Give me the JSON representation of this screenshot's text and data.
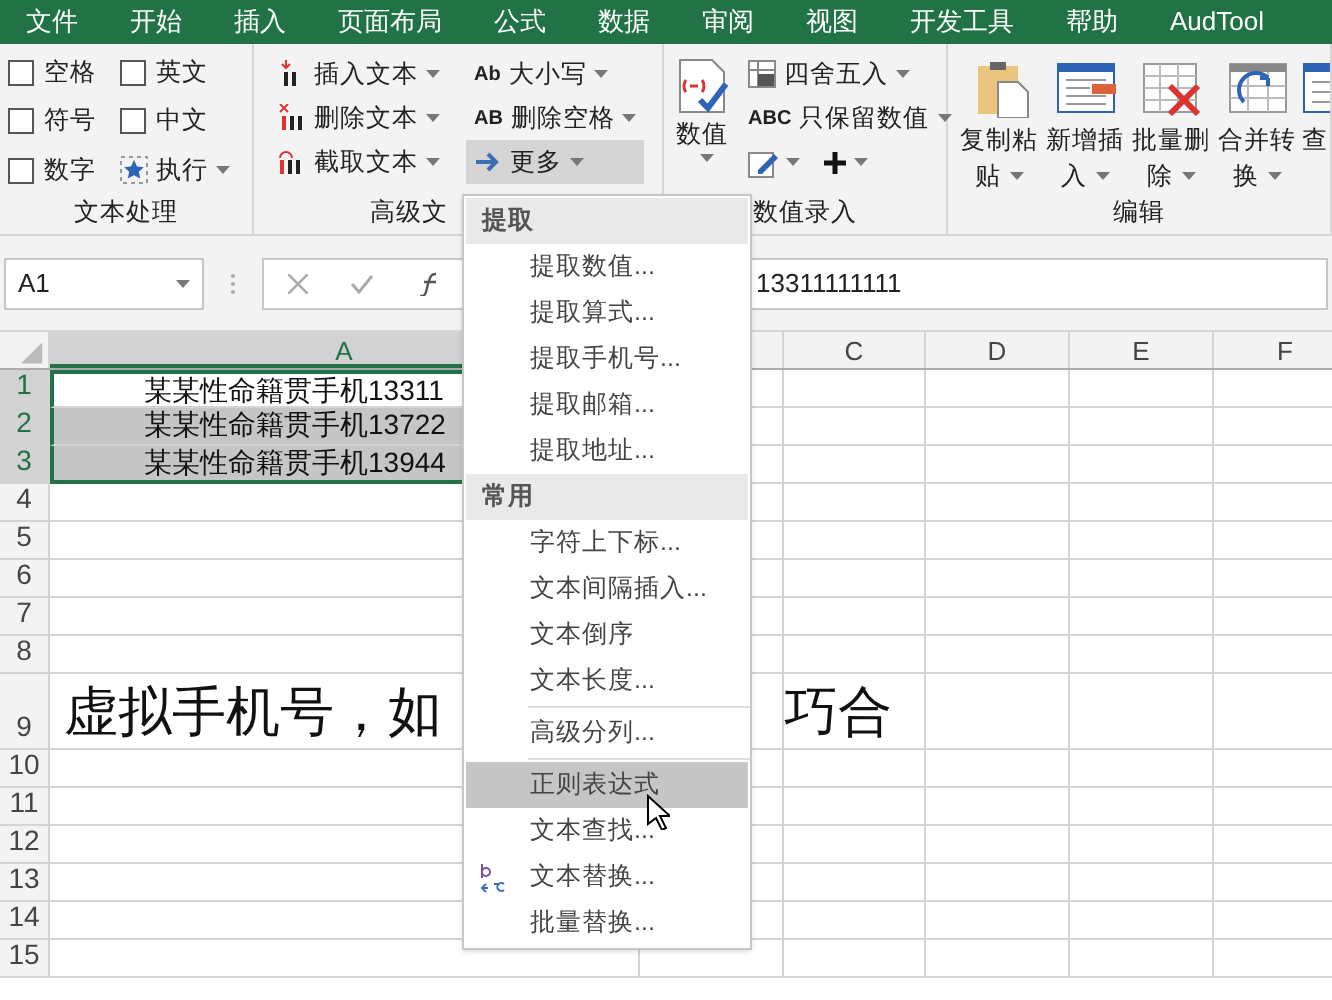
{
  "menu_bar": {
    "tabs": [
      "文件",
      "开始",
      "插入",
      "页面布局",
      "公式",
      "数据",
      "审阅",
      "视图",
      "开发工具",
      "帮助",
      "AudTool"
    ]
  },
  "ribbon": {
    "groups": [
      {
        "label": "文本处理",
        "items": [
          {
            "kind": "checkbox",
            "label": "空格",
            "checked": false
          },
          {
            "kind": "checkbox",
            "label": "英文",
            "checked": false
          },
          {
            "kind": "checkbox",
            "label": "符号",
            "checked": false
          },
          {
            "kind": "checkbox",
            "label": "中文",
            "checked": false
          },
          {
            "kind": "checkbox",
            "label": "数字",
            "checked": false
          },
          {
            "kind": "run",
            "label": "执行"
          }
        ]
      },
      {
        "label": "高级文",
        "items": [
          {
            "kind": "insert",
            "label": "插入文本",
            "selected": false
          },
          {
            "kind": "delete",
            "label": "删除文本",
            "selected": false
          },
          {
            "kind": "cut",
            "label": "截取文本",
            "selected": false
          },
          {
            "kind": "case",
            "icon_text": "Ab",
            "label": "大小写",
            "selected": false
          },
          {
            "kind": "trim",
            "icon_text": "AB",
            "label": "删除空格",
            "selected": false
          },
          {
            "kind": "more",
            "label": "更多",
            "selected": true
          }
        ]
      },
      {
        "label": "数值录入",
        "items": [
          {
            "kind": "large",
            "label": "数值"
          },
          {
            "kind": "round",
            "label": "四舍五入"
          },
          {
            "kind": "numonly",
            "icon_text": "ABC",
            "label": "只保留数值"
          },
          {
            "kind": "pencil"
          },
          {
            "kind": "plus"
          }
        ]
      },
      {
        "label": "编辑",
        "items": [
          {
            "kind": "paste",
            "line1": "复制粘",
            "line2": "贴",
            "dropdown": true
          },
          {
            "kind": "insertrow",
            "line1": "新增插",
            "line2": "入",
            "dropdown": true
          },
          {
            "kind": "deleterow",
            "line1": "批量删",
            "line2": "除",
            "dropdown": true
          },
          {
            "kind": "convert",
            "line1": "合并转",
            "line2": "换",
            "dropdown": true
          },
          {
            "kind": "find",
            "line1": "查"
          }
        ]
      }
    ]
  },
  "formula_bar": {
    "name_box": "A1",
    "formula": "13311111111"
  },
  "sheet": {
    "columns": [
      {
        "label": "A",
        "selected": true
      },
      {
        "label": "C",
        "selected": false
      },
      {
        "label": "D",
        "selected": false
      },
      {
        "label": "E",
        "selected": false
      },
      {
        "label": "F",
        "selected": false
      }
    ],
    "rows": [
      {
        "num": "1",
        "a": "某某性命籍贯手机13311",
        "selected": true,
        "active": true
      },
      {
        "num": "2",
        "a": "某某性命籍贯手机13722",
        "selected": true,
        "active": false
      },
      {
        "num": "3",
        "a": "某某性命籍贯手机13944",
        "selected": true,
        "active": false
      },
      {
        "num": "4",
        "selected": false
      },
      {
        "num": "5",
        "selected": false
      },
      {
        "num": "6",
        "selected": false
      },
      {
        "num": "7",
        "selected": false
      },
      {
        "num": "8",
        "selected": false
      },
      {
        "num": "9",
        "a": "虚拟手机号，如",
        "overflow": "巧合",
        "tall": true,
        "selected": false
      },
      {
        "num": "10",
        "selected": false
      },
      {
        "num": "11",
        "selected": false
      },
      {
        "num": "12",
        "selected": false
      },
      {
        "num": "13",
        "selected": false
      },
      {
        "num": "14",
        "selected": false
      },
      {
        "num": "15",
        "selected": false
      }
    ]
  },
  "dropdown_menu": {
    "sections": [
      {
        "header": "提取",
        "items": [
          {
            "label": "提取数值...",
            "highlighted": false
          },
          {
            "label": "提取算式...",
            "highlighted": false
          },
          {
            "label": "提取手机号...",
            "highlighted": false
          },
          {
            "label": "提取邮箱...",
            "highlighted": false
          },
          {
            "label": "提取地址...",
            "highlighted": false
          }
        ]
      },
      {
        "header": "常用",
        "items": [
          {
            "label": "字符上下标...",
            "highlighted": false
          },
          {
            "label": "文本间隔插入...",
            "highlighted": false
          },
          {
            "label": "文本倒序",
            "highlighted": false
          },
          {
            "label": "文本长度...",
            "highlighted": false
          },
          {
            "label": "高级分列...",
            "highlighted": false,
            "separator_before": true
          },
          {
            "label": "正则表达式",
            "highlighted": true,
            "separator_before": true
          },
          {
            "label": "文本查找...",
            "highlighted": false
          },
          {
            "label": "文本替换...",
            "highlighted": false,
            "kind": "with_icon"
          },
          {
            "label": "批量替换...",
            "highlighted": false
          }
        ]
      }
    ]
  }
}
